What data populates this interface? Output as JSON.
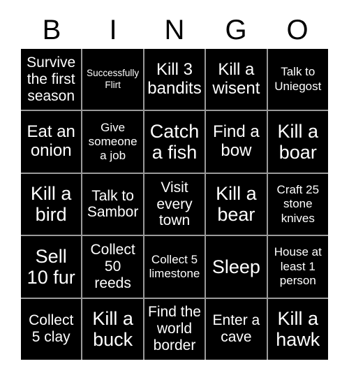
{
  "card": {
    "title": "BINGO",
    "colors": {
      "cell_background": "#000000",
      "cell_text": "#ffffff",
      "page_background": "#ffffff",
      "grid_line": "#9a9a9a",
      "header_text": "#000000"
    },
    "header": {
      "letters": [
        "B",
        "I",
        "N",
        "G",
        "O"
      ]
    },
    "columns": 5,
    "rows": 5,
    "cells": [
      {
        "text": "Survive the first season",
        "size": "md",
        "row": 1,
        "col": 1
      },
      {
        "text": "Successfully Flirt",
        "size": "xs",
        "row": 1,
        "col": 2
      },
      {
        "text": "Kill 3 bandits",
        "size": "lg",
        "row": 1,
        "col": 3
      },
      {
        "text": "Kill a wisent",
        "size": "lg",
        "row": 1,
        "col": 4
      },
      {
        "text": "Talk to Uniegost",
        "size": "sm",
        "row": 1,
        "col": 5
      },
      {
        "text": "Eat an onion",
        "size": "lg",
        "row": 2,
        "col": 1
      },
      {
        "text": "Give someone a job",
        "size": "sm",
        "row": 2,
        "col": 2
      },
      {
        "text": "Catch a fish",
        "size": "xl",
        "row": 2,
        "col": 3
      },
      {
        "text": "Find a bow",
        "size": "lg",
        "row": 2,
        "col": 4
      },
      {
        "text": "Kill a boar",
        "size": "xl",
        "row": 2,
        "col": 5
      },
      {
        "text": "Kill a bird",
        "size": "xl",
        "row": 3,
        "col": 1
      },
      {
        "text": "Talk to Sambor",
        "size": "md",
        "row": 3,
        "col": 2
      },
      {
        "text": "Visit every town",
        "size": "md",
        "row": 3,
        "col": 3
      },
      {
        "text": "Kill a bear",
        "size": "xl",
        "row": 3,
        "col": 4
      },
      {
        "text": "Craft 25 stone knives",
        "size": "sm",
        "row": 3,
        "col": 5
      },
      {
        "text": "Sell 10 fur",
        "size": "xl",
        "row": 4,
        "col": 1
      },
      {
        "text": "Collect 50 reeds",
        "size": "md",
        "row": 4,
        "col": 2
      },
      {
        "text": "Collect 5 limestone",
        "size": "sm",
        "row": 4,
        "col": 3
      },
      {
        "text": "Sleep",
        "size": "xl",
        "row": 4,
        "col": 4
      },
      {
        "text": "House at least 1 person",
        "size": "sm",
        "row": 4,
        "col": 5
      },
      {
        "text": "Collect 5 clay",
        "size": "md",
        "row": 5,
        "col": 1
      },
      {
        "text": "Kill a buck",
        "size": "xl",
        "row": 5,
        "col": 2
      },
      {
        "text": "Find the world border",
        "size": "md",
        "row": 5,
        "col": 3
      },
      {
        "text": "Enter a cave",
        "size": "md",
        "row": 5,
        "col": 4
      },
      {
        "text": "Kill a hawk",
        "size": "xl",
        "row": 5,
        "col": 5
      }
    ]
  }
}
